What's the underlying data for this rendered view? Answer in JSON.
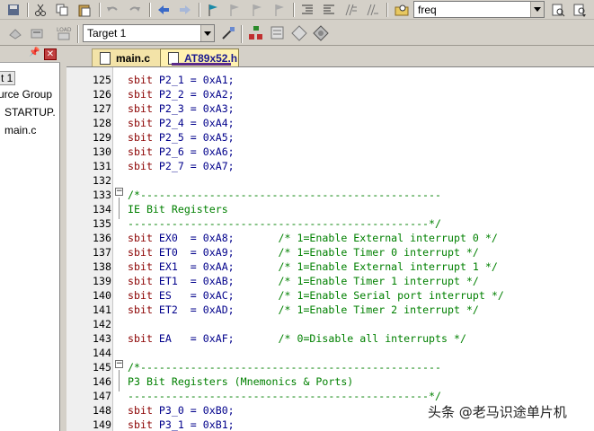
{
  "toolbar": {
    "find_value": "freq",
    "target_value": "Target 1"
  },
  "project": {
    "items": [
      "t 1",
      "urce Group",
      "STARTUP.",
      "main.c"
    ]
  },
  "tabs": [
    {
      "label": "main.c"
    },
    {
      "label": "AT89x52.h"
    }
  ],
  "editor": {
    "lines": [
      {
        "n": "125",
        "kw": "sbit",
        "rest": " P2_1 = 0xA1;",
        "cm": ""
      },
      {
        "n": "126",
        "kw": "sbit",
        "rest": " P2_2 = 0xA2;",
        "cm": ""
      },
      {
        "n": "127",
        "kw": "sbit",
        "rest": " P2_3 = 0xA3;",
        "cm": ""
      },
      {
        "n": "128",
        "kw": "sbit",
        "rest": " P2_4 = 0xA4;",
        "cm": ""
      },
      {
        "n": "129",
        "kw": "sbit",
        "rest": " P2_5 = 0xA5;",
        "cm": ""
      },
      {
        "n": "130",
        "kw": "sbit",
        "rest": " P2_6 = 0xA6;",
        "cm": ""
      },
      {
        "n": "131",
        "kw": "sbit",
        "rest": " P2_7 = 0xA7;",
        "cm": ""
      },
      {
        "n": "132",
        "kw": "",
        "rest": "",
        "cm": ""
      },
      {
        "n": "133",
        "kw": "",
        "rest": "",
        "cm": "/*------------------------------------------------"
      },
      {
        "n": "134",
        "kw": "",
        "rest": "",
        "cm": "IE Bit Registers"
      },
      {
        "n": "135",
        "kw": "",
        "rest": "",
        "cm": "------------------------------------------------*/"
      },
      {
        "n": "136",
        "kw": "sbit",
        "rest": " EX0  = 0xA8;       ",
        "cm": "/* 1=Enable External interrupt 0 */"
      },
      {
        "n": "137",
        "kw": "sbit",
        "rest": " ET0  = 0xA9;       ",
        "cm": "/* 1=Enable Timer 0 interrupt */"
      },
      {
        "n": "138",
        "kw": "sbit",
        "rest": " EX1  = 0xAA;       ",
        "cm": "/* 1=Enable External interrupt 1 */"
      },
      {
        "n": "139",
        "kw": "sbit",
        "rest": " ET1  = 0xAB;       ",
        "cm": "/* 1=Enable Timer 1 interrupt */"
      },
      {
        "n": "140",
        "kw": "sbit",
        "rest": " ES   = 0xAC;       ",
        "cm": "/* 1=Enable Serial port interrupt */"
      },
      {
        "n": "141",
        "kw": "sbit",
        "rest": " ET2  = 0xAD;       ",
        "cm": "/* 1=Enable Timer 2 interrupt */"
      },
      {
        "n": "142",
        "kw": "",
        "rest": "",
        "cm": ""
      },
      {
        "n": "143",
        "kw": "sbit",
        "rest": " EA   = 0xAF;       ",
        "cm": "/* 0=Disable all interrupts */"
      },
      {
        "n": "144",
        "kw": "",
        "rest": "",
        "cm": ""
      },
      {
        "n": "145",
        "kw": "",
        "rest": "",
        "cm": "/*------------------------------------------------"
      },
      {
        "n": "146",
        "kw": "",
        "rest": "",
        "cm": "P3 Bit Registers (Mnemonics & Ports)"
      },
      {
        "n": "147",
        "kw": "",
        "rest": "",
        "cm": "------------------------------------------------*/"
      },
      {
        "n": "148",
        "kw": "sbit",
        "rest": " P3_0 = 0xB0;",
        "cm": ""
      },
      {
        "n": "149",
        "kw": "sbit",
        "rest": " P3_1 = 0xB1;",
        "cm": ""
      }
    ]
  },
  "watermark": "头条 @老马识途单片机",
  "colors": {
    "keyword": "#8b0000",
    "code": "#00008b",
    "comment": "#008000",
    "tab_active": "#fff2b0"
  }
}
